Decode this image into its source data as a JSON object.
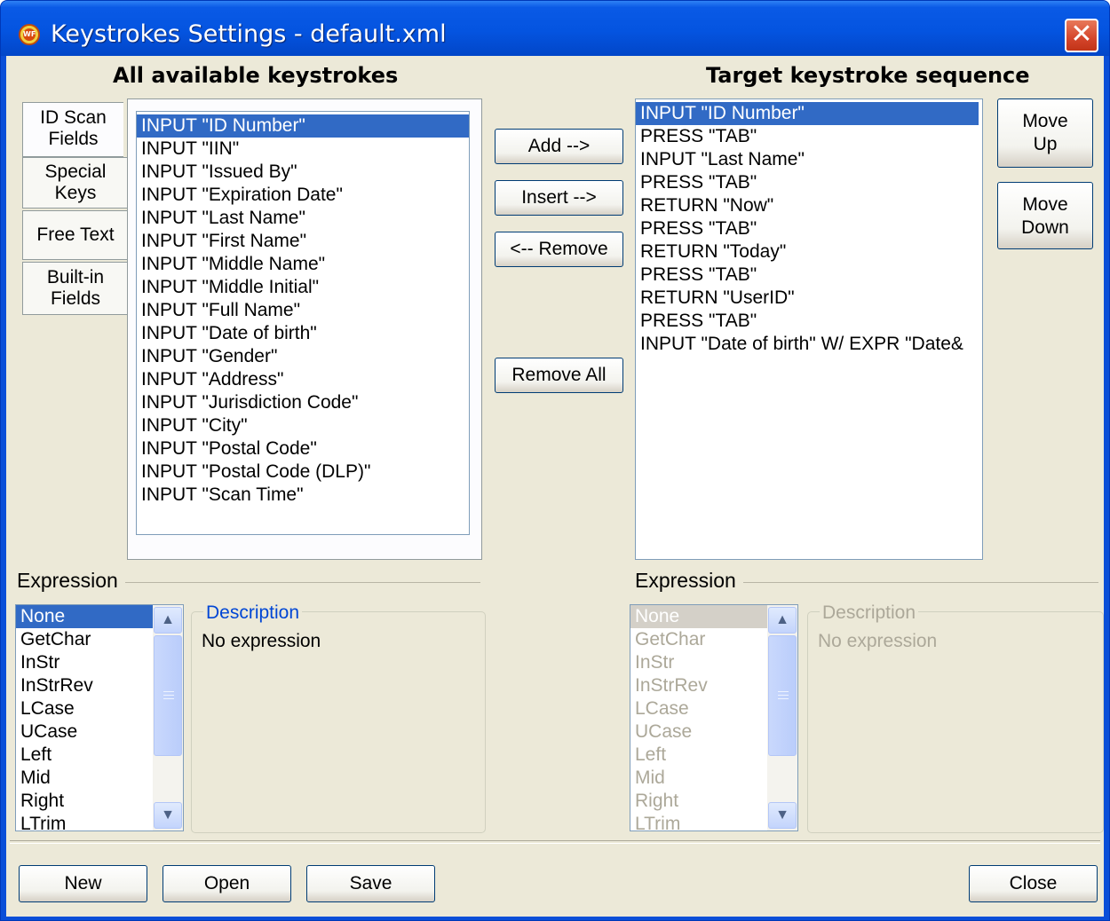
{
  "window": {
    "title": "Keystrokes Settings - default.xml",
    "close_glyph": "✕"
  },
  "left": {
    "heading": "All available keystrokes",
    "tabs": [
      {
        "line1": "ID Scan",
        "line2": "Fields"
      },
      {
        "line1": "Special",
        "line2": "Keys"
      },
      {
        "line1": "Free Text",
        "line2": ""
      },
      {
        "line1": "Built-in",
        "line2": "Fields"
      }
    ],
    "items": [
      "INPUT \"ID Number\"",
      "INPUT \"IIN\"",
      "INPUT \"Issued By\"",
      "INPUT \"Expiration Date\"",
      "INPUT \"Last Name\"",
      "INPUT \"First Name\"",
      "INPUT \"Middle Name\"",
      "INPUT \"Middle Initial\"",
      "INPUT \"Full Name\"",
      "INPUT \"Date of birth\"",
      "INPUT \"Gender\"",
      "INPUT \"Address\"",
      "INPUT \"Jurisdiction Code\"",
      "INPUT \"City\"",
      "INPUT \"Postal Code\"",
      "INPUT \"Postal Code (DLP)\"",
      "INPUT \"Scan Time\""
    ],
    "expression_label": "Expression",
    "expressions": [
      "None",
      "GetChar",
      "InStr",
      "InStrRev",
      "LCase",
      "UCase",
      "Left",
      "Mid",
      "Right",
      "LTrim"
    ],
    "description_title": "Description",
    "description_text": "No expression"
  },
  "middle": {
    "add": "Add -->",
    "insert": "Insert -->",
    "remove": "<-- Remove",
    "remove_all": "Remove All"
  },
  "right": {
    "heading": "Target keystroke sequence",
    "items": [
      "INPUT \"ID Number\"",
      "PRESS \"TAB\"",
      "INPUT \"Last Name\"",
      "PRESS \"TAB\"",
      "RETURN \"Now\"",
      "PRESS \"TAB\"",
      "RETURN \"Today\"",
      "PRESS \"TAB\"",
      "RETURN \"UserID\"",
      "PRESS \"TAB\"",
      "INPUT \"Date of birth\" W/ EXPR \"Date&"
    ],
    "move_up": {
      "line1": "Move",
      "line2": "Up"
    },
    "move_down": {
      "line1": "Move",
      "line2": "Down"
    },
    "expression_label": "Expression",
    "expressions": [
      "None",
      "GetChar",
      "InStr",
      "InStrRev",
      "LCase",
      "UCase",
      "Left",
      "Mid",
      "Right",
      "LTrim"
    ],
    "description_title": "Description",
    "description_text": "No expression"
  },
  "footer": {
    "new": "New",
    "open": "Open",
    "save": "Save",
    "close": "Close"
  },
  "scroll_glyphs": {
    "up": "▲",
    "down": "▼"
  }
}
